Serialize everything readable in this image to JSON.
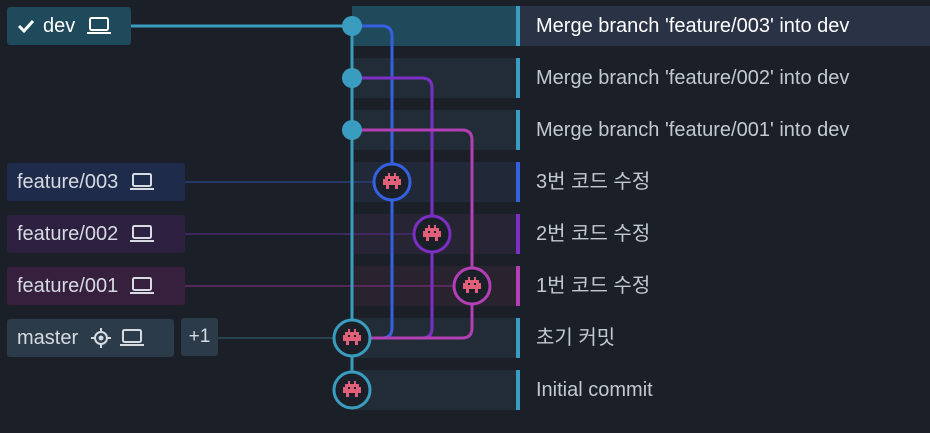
{
  "colors": {
    "dev": "#3a9dbf",
    "feature_003": "#3560e0",
    "feature_002": "#7b2fc4",
    "feature_001": "#b23fb3",
    "master": "#3a9dbf",
    "selection": "#2a3246",
    "background": "#1b2028"
  },
  "refs": {
    "dev": {
      "label": "dev",
      "icons": [
        "check-icon",
        "laptop-icon"
      ]
    },
    "feature_003": {
      "label": "feature/003",
      "icons": [
        "laptop-icon"
      ]
    },
    "feature_002": {
      "label": "feature/002",
      "icons": [
        "laptop-icon"
      ]
    },
    "feature_001": {
      "label": "feature/001",
      "icons": [
        "laptop-icon"
      ]
    },
    "master": {
      "label": "master",
      "icons": [
        "target-icon",
        "laptop-icon"
      ]
    },
    "more": "+1"
  },
  "commits": [
    {
      "message": "Merge branch 'feature/003' into dev",
      "selected": true
    },
    {
      "message": "Merge branch 'feature/002' into dev"
    },
    {
      "message": "Merge branch 'feature/001' into dev"
    },
    {
      "message": "3번 코드 수정"
    },
    {
      "message": "2번 코드 수정"
    },
    {
      "message": "1번 코드 수정"
    },
    {
      "message": "초기 커밋"
    },
    {
      "message": "Initial commit"
    }
  ]
}
